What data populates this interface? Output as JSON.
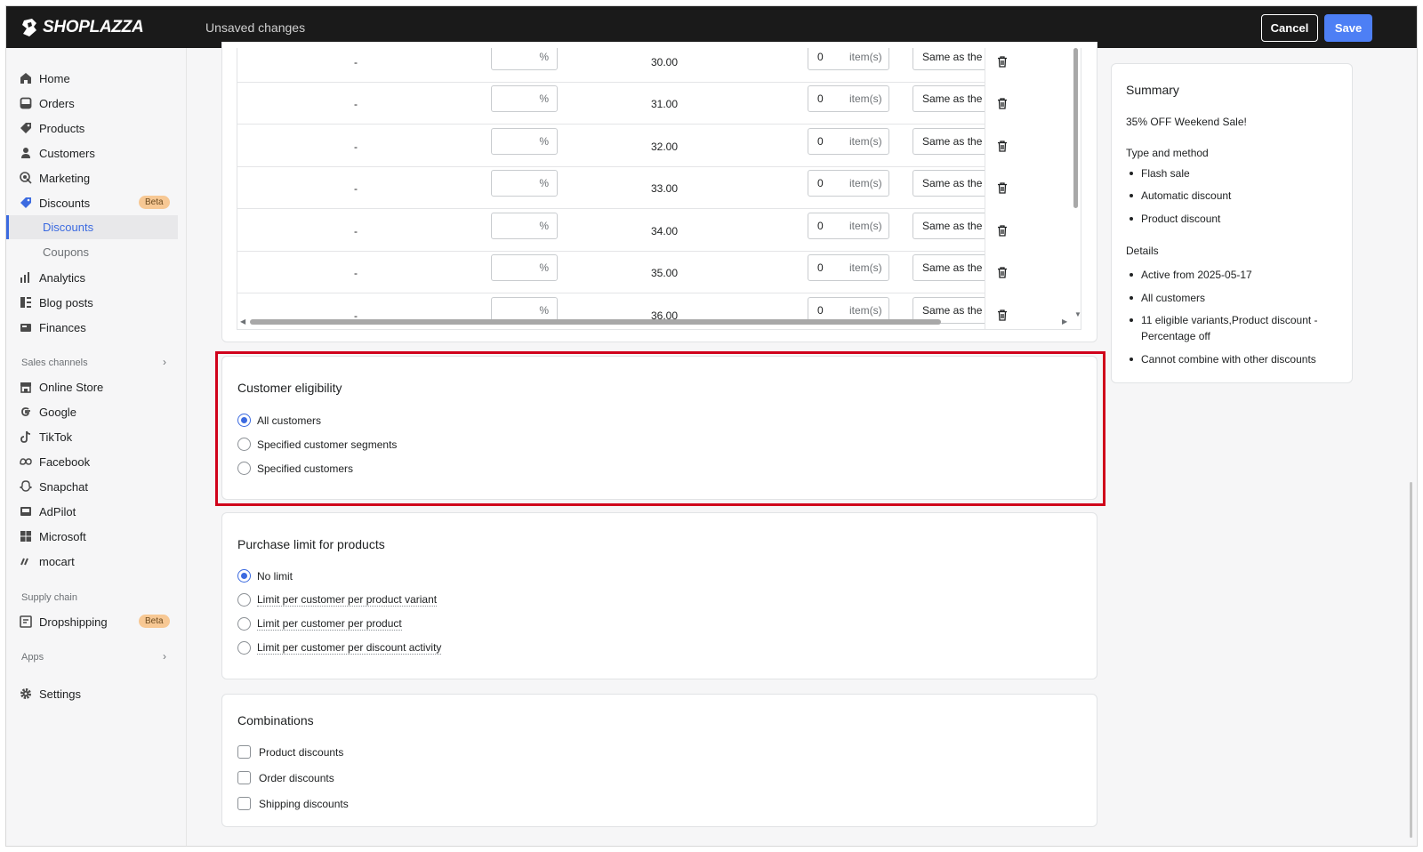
{
  "header": {
    "brand": "SHOPLAZZA",
    "status": "Unsaved changes",
    "cancel_label": "Cancel",
    "save_label": "Save"
  },
  "sidebar": {
    "items": [
      {
        "label": "Home",
        "icon": "home-icon"
      },
      {
        "label": "Orders",
        "icon": "orders-icon"
      },
      {
        "label": "Products",
        "icon": "tag-icon"
      },
      {
        "label": "Customers",
        "icon": "person-icon"
      },
      {
        "label": "Marketing",
        "icon": "target-icon"
      },
      {
        "label": "Discounts",
        "icon": "discount-icon",
        "badge": "Beta"
      }
    ],
    "sub_items": [
      {
        "label": "Discounts",
        "active": true
      },
      {
        "label": "Coupons",
        "active": false
      }
    ],
    "items2": [
      {
        "label": "Analytics",
        "icon": "bar-chart-icon"
      },
      {
        "label": "Blog posts",
        "icon": "blog-icon"
      },
      {
        "label": "Finances",
        "icon": "finance-icon"
      }
    ],
    "sales_channels_label": "Sales channels",
    "channels": [
      {
        "label": "Online Store",
        "icon": "store-icon"
      },
      {
        "label": "Google",
        "icon": "google-icon"
      },
      {
        "label": "TikTok",
        "icon": "tiktok-icon"
      },
      {
        "label": "Facebook",
        "icon": "meta-icon"
      },
      {
        "label": "Snapchat",
        "icon": "snapchat-icon"
      },
      {
        "label": "AdPilot",
        "icon": "adpilot-icon"
      },
      {
        "label": "Microsoft",
        "icon": "microsoft-icon"
      },
      {
        "label": "mocart",
        "icon": "mocart-icon"
      }
    ],
    "supply_chain_label": "Supply chain",
    "dropshipping": {
      "label": "Dropshipping",
      "badge": "Beta"
    },
    "apps_label": "Apps",
    "settings_label": "Settings"
  },
  "variants_table": {
    "rows": [
      {
        "original": "-",
        "percent_unit": "%",
        "price": "30.00",
        "qty": "0",
        "qty_unit": "item(s)",
        "limit": "Same as the product"
      },
      {
        "original": "-",
        "percent_unit": "%",
        "price": "31.00",
        "qty": "0",
        "qty_unit": "item(s)",
        "limit": "Same as the product"
      },
      {
        "original": "-",
        "percent_unit": "%",
        "price": "32.00",
        "qty": "0",
        "qty_unit": "item(s)",
        "limit": "Same as the product"
      },
      {
        "original": "-",
        "percent_unit": "%",
        "price": "33.00",
        "qty": "0",
        "qty_unit": "item(s)",
        "limit": "Same as the product"
      },
      {
        "original": "-",
        "percent_unit": "%",
        "price": "34.00",
        "qty": "0",
        "qty_unit": "item(s)",
        "limit": "Same as the product"
      },
      {
        "original": "-",
        "percent_unit": "%",
        "price": "35.00",
        "qty": "0",
        "qty_unit": "item(s)",
        "limit": "Same as the product"
      },
      {
        "original": "-",
        "percent_unit": "%",
        "price": "36.00",
        "qty": "0",
        "qty_unit": "item(s)",
        "limit": "Same as the product"
      }
    ]
  },
  "customer_eligibility": {
    "title": "Customer eligibility",
    "options": [
      {
        "label": "All customers",
        "selected": true
      },
      {
        "label": "Specified customer segments",
        "selected": false
      },
      {
        "label": "Specified customers",
        "selected": false
      }
    ],
    "highlight_color": "#d0021b"
  },
  "purchase_limit": {
    "title": "Purchase limit for products",
    "options": [
      {
        "label": "No limit",
        "selected": true
      },
      {
        "label": "Limit per customer per product variant",
        "selected": false
      },
      {
        "label": "Limit per customer per product",
        "selected": false
      },
      {
        "label": "Limit per customer per discount activity",
        "selected": false
      }
    ]
  },
  "combinations": {
    "title": "Combinations",
    "options": [
      {
        "label": "Product discounts",
        "checked": false
      },
      {
        "label": "Order discounts",
        "checked": false
      },
      {
        "label": "Shipping discounts",
        "checked": false
      }
    ]
  },
  "summary": {
    "title": "Summary",
    "name": "35% OFF Weekend Sale!",
    "type_heading": "Type and method",
    "type_items": [
      "Flash sale",
      "Automatic discount",
      "Product discount"
    ],
    "details_heading": "Details",
    "details_items": [
      "Active from 2025-05-17",
      "All customers",
      "11 eligible variants,Product discount - Percentage off",
      "Cannot combine with other discounts"
    ]
  },
  "colors": {
    "accent": "#3b6ae0",
    "save_button": "#4d7ff5",
    "topbar": "#1a1a1a",
    "beta_badge": "#f7c894"
  }
}
